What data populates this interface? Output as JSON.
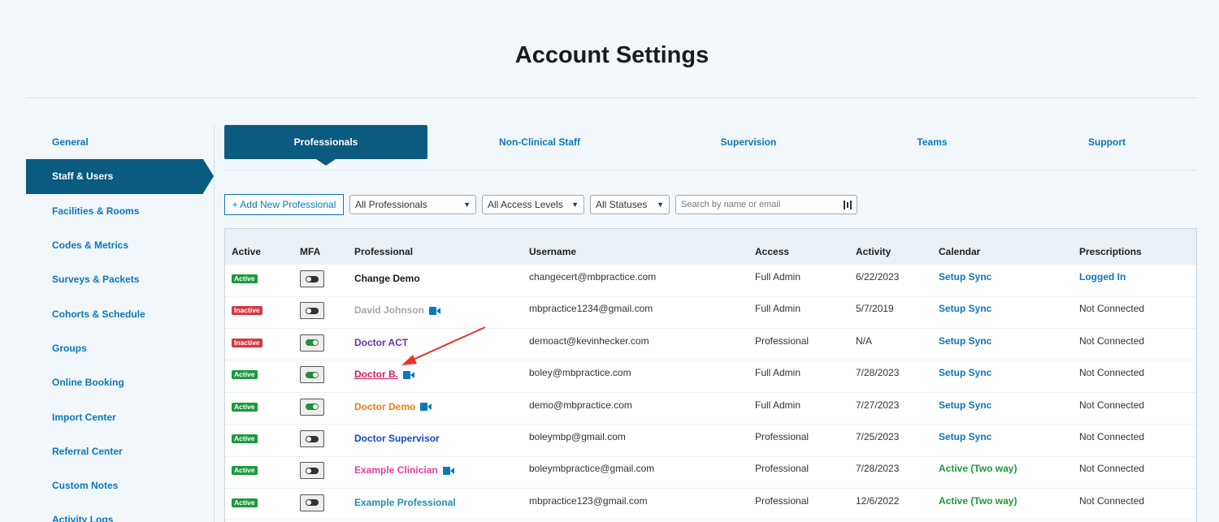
{
  "page": {
    "title": "Account Settings"
  },
  "sidebar": {
    "items": [
      {
        "label": "General",
        "active": false
      },
      {
        "label": "Staff & Users",
        "active": true
      },
      {
        "label": "Facilities & Rooms",
        "active": false
      },
      {
        "label": "Codes & Metrics",
        "active": false
      },
      {
        "label": "Surveys & Packets",
        "active": false
      },
      {
        "label": "Cohorts & Schedule",
        "active": false
      },
      {
        "label": "Groups",
        "active": false
      },
      {
        "label": "Online Booking",
        "active": false
      },
      {
        "label": "Import Center",
        "active": false
      },
      {
        "label": "Referral Center",
        "active": false
      },
      {
        "label": "Custom Notes",
        "active": false
      },
      {
        "label": "Activity Logs",
        "active": false
      }
    ]
  },
  "tabs": [
    {
      "label": "Professionals",
      "active": true
    },
    {
      "label": "Non-Clinical Staff",
      "active": false
    },
    {
      "label": "Supervision",
      "active": false
    },
    {
      "label": "Teams",
      "active": false
    },
    {
      "label": "Support",
      "active": false
    }
  ],
  "filters": {
    "add_label": "+ Add New Professional",
    "professionals_select": "All Professionals",
    "access_select": "All Access Levels",
    "status_select": "All Statuses",
    "search_placeholder": "Search by name or email"
  },
  "table": {
    "headers": [
      "Active",
      "MFA",
      "Professional",
      "Username",
      "Access",
      "Activity",
      "Calendar",
      "Prescriptions"
    ],
    "rows": [
      {
        "status": "Active",
        "status_on": true,
        "mfa": false,
        "name": "Change Demo",
        "name_color": "#1b1b1b",
        "video": false,
        "username": "changecert@mbpractice.com",
        "access": "Full Admin",
        "activity": "6/22/2023",
        "calendar": "Setup Sync",
        "calendar_style": "blue",
        "prescriptions": "Logged In",
        "rx_link": true
      },
      {
        "status": "Inactive",
        "status_on": false,
        "mfa": false,
        "name": "David Johnson",
        "name_color": "#a9a9a9",
        "video": true,
        "username": "mbpractice1234@gmail.com",
        "access": "Full Admin",
        "activity": "5/7/2019",
        "calendar": "Setup Sync",
        "calendar_style": "blue",
        "prescriptions": "Not Connected",
        "rx_link": false
      },
      {
        "status": "Inactive",
        "status_on": false,
        "mfa": true,
        "name": "Doctor ACT",
        "name_color": "#6a2fb5",
        "video": false,
        "username": "demoact@kevinhecker.com",
        "access": "Professional",
        "activity": "N/A",
        "calendar": "Setup Sync",
        "calendar_style": "blue",
        "prescriptions": "Not Connected",
        "rx_link": false
      },
      {
        "status": "Active",
        "status_on": true,
        "mfa": true,
        "name": "Doctor B.",
        "name_color": "#d81b60",
        "video": true,
        "underline": true,
        "username": "boley@mbpractice.com",
        "access": "Full Admin",
        "activity": "7/28/2023",
        "calendar": "Setup Sync",
        "calendar_style": "blue",
        "prescriptions": "Not Connected",
        "rx_link": false
      },
      {
        "status": "Active",
        "status_on": true,
        "mfa": true,
        "name": "Doctor Demo",
        "name_color": "#f07c1a",
        "video": true,
        "username": "demo@mbpractice.com",
        "access": "Full Admin",
        "activity": "7/27/2023",
        "calendar": "Setup Sync",
        "calendar_style": "blue",
        "prescriptions": "Not Connected",
        "rx_link": false
      },
      {
        "status": "Active",
        "status_on": true,
        "mfa": false,
        "name": "Doctor Supervisor",
        "name_color": "#1746c9",
        "video": false,
        "username": "boleymbp@gmail.com",
        "access": "Professional",
        "activity": "7/25/2023",
        "calendar": "Setup Sync",
        "calendar_style": "blue",
        "prescriptions": "Not Connected",
        "rx_link": false
      },
      {
        "status": "Active",
        "status_on": true,
        "mfa": false,
        "name": "Example Clinician",
        "name_color": "#e43fa8",
        "video": true,
        "username": "boleymbpractice@gmail.com",
        "access": "Professional",
        "activity": "7/28/2023",
        "calendar": "Active (Two way)",
        "calendar_style": "green",
        "prescriptions": "Not Connected",
        "rx_link": false
      },
      {
        "status": "Active",
        "status_on": true,
        "mfa": false,
        "name": "Example Professional",
        "name_color": "#1f8fb0",
        "video": false,
        "username": "mbpractice123@gmail.com",
        "access": "Professional",
        "activity": "12/6/2022",
        "calendar": "Active (Two way)",
        "calendar_style": "green",
        "prescriptions": "Not Connected",
        "rx_link": false
      }
    ]
  },
  "colors": {
    "accent": "#0b5a80",
    "link": "#0d78b8",
    "active_badge": "#1b9a3d",
    "inactive_badge": "#d7373f",
    "annotation_arrow": "#e8322b"
  },
  "icons": {
    "video": "video-camera-icon",
    "search": "barcode-search-icon"
  }
}
